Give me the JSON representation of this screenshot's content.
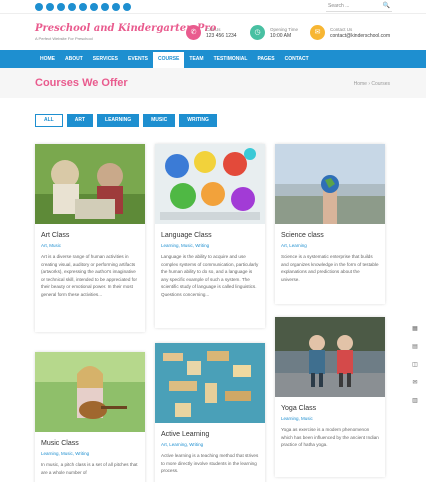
{
  "topbar": {
    "social_icons": [
      "facebook-icon",
      "twitter-icon",
      "instagram-icon",
      "youtube-icon",
      "pinterest-icon",
      "linkedin-icon",
      "snapchat-icon",
      "youtube-icon",
      "vk-icon"
    ],
    "search_placeholder": "Search ...",
    "search_icon": "🔍"
  },
  "header": {
    "logo": "Preschool and Kindergarten Pro",
    "tagline": "A Perfect Website For Preschool",
    "call": {
      "label": "Call Us",
      "value": "123 456 1234",
      "icon": "✆",
      "color": "#e95b8e"
    },
    "hours": {
      "label": "Opening Time",
      "value": "10:00 AM",
      "icon": "◷",
      "color": "#49c0a2"
    },
    "contact": {
      "label": "Contact Us",
      "value": "contact@kinderschool.com",
      "icon": "✉",
      "color": "#f7b633"
    }
  },
  "nav": {
    "items": [
      {
        "label": "HOME"
      },
      {
        "label": "ABOUT"
      },
      {
        "label": "SERVICES"
      },
      {
        "label": "EVENTS"
      },
      {
        "label": "COURSE",
        "active": true
      },
      {
        "label": "TEAM"
      },
      {
        "label": "TESTIMONIAL"
      },
      {
        "label": "PAGES"
      },
      {
        "label": "CONTACT"
      }
    ]
  },
  "page": {
    "title": "Courses We Offer",
    "breadcrumb": "Home  ›  Courses"
  },
  "filters": [
    "ALL",
    "ART",
    "LEARNING",
    "MUSIC",
    "WRITING"
  ],
  "courses": [
    {
      "title": "Art Class",
      "tags": "Art, Music",
      "desc": "Art is a diverse range of human activities in creating visual, auditory or performing artifacts (artworks), expressing the author's imaginative or technical skill, intended to be appreciated for their beauty or emotional power. In their most general form these activities..."
    },
    {
      "title": "Language Class",
      "tags": "Learning, Music, Writing",
      "desc": "Language is the ability to acquire and use complex systems of communication, particularly the human ability to do so, and a language is any specific example of such a system. The scientific study of language is called linguistics. Questions concerning..."
    },
    {
      "title": "Science class",
      "tags": "Art, Learning",
      "desc": "Science is a systematic enterprise that builds and organizes knowledge in the form of testable explanations and predictions about the universe."
    },
    {
      "title": "Music Class",
      "tags": "Learning, Music, Writing",
      "desc": "In music, a pitch class is a set of all pitches that are a whole number of"
    },
    {
      "title": "Active Learning",
      "tags": "Art, Learning, Writing",
      "desc": "Active learning is a teaching method that strives to more directly involve students in the learning process."
    },
    {
      "title": "Yoga Class",
      "tags": "Learning, Music",
      "desc": "Yoga as exercise is a modern phenomenon which has been influenced by the ancient Indian practice of hatha yoga."
    }
  ],
  "side_icons": [
    "grid-icon",
    "cart-icon",
    "info-icon",
    "mail-icon",
    "doc-icon"
  ]
}
